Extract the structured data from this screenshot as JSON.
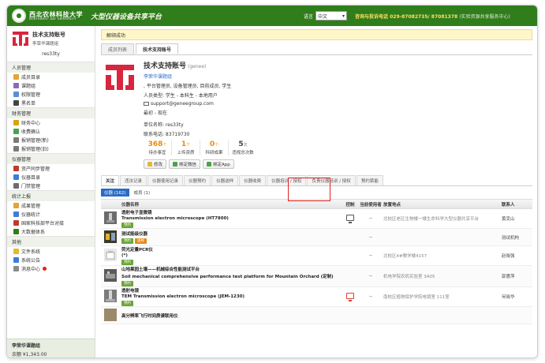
{
  "header": {
    "logo_cn": "西北农林科技大学",
    "logo_en": "NORTHWEST A&F UNIVERSITY",
    "slogan": "大型仪器设备共享平台",
    "lang_label": "语言",
    "lang_value": "中文",
    "hotline": "咨询与投诉电话 029-87082735/ 87081378",
    "hotline_note": "(实验资源共享服务中心)"
  },
  "sidebar": {
    "user_name": "技术支持账号",
    "user_group": "李荣华课题组",
    "user_id": "res33ty",
    "groups": [
      {
        "title": "人员管理",
        "items": [
          "成员目录",
          "课题组",
          "权限管理",
          "黑名单"
        ]
      },
      {
        "title": "财务管理",
        "items": [
          "财务中心",
          "收费确认",
          "报销管理(新)",
          "报销管理(旧)"
        ]
      },
      {
        "title": "仪器管理",
        "items": [
          "资产同步管理",
          "仪器目录",
          "门禁管理"
        ]
      },
      {
        "title": "统计上报",
        "items": [
          "成果管理",
          "仪器统计",
          "国家科技部平台对接",
          "大数据体系"
        ]
      },
      {
        "title": "其他",
        "items": [
          "文件系统",
          "系统公告",
          "消息中心"
        ]
      }
    ],
    "footer_group": "李荣华课题组",
    "footer_balance": "¥1,343.00"
  },
  "main": {
    "notice": "解绑成功",
    "top_tabs": [
      "成员列表",
      "技术支持账号"
    ],
    "profile": {
      "name": "技术支持账号",
      "account": "(genee)",
      "group": "李荣华课题组",
      "roles": ", 平台管理员, 设备管理员, 目前成员, 学生",
      "type": "人员类型: 学生 - 本科生 - 本地用户",
      "email": "support@geneegroup.com",
      "period": "最初 - 现在",
      "unit": "单位名称: res33ty",
      "phone": "联系电话: 83719730"
    },
    "stats": [
      {
        "value": "368",
        "unit": "个",
        "label": "待办事宜",
        "accent": true
      },
      {
        "value": "1",
        "unit": "个",
        "label": "上传资质",
        "accent": true
      },
      {
        "value": "0",
        "unit": "个",
        "label": "科研成果",
        "accent": true
      },
      {
        "value": "5",
        "unit": "次",
        "label": "违规总次数",
        "accent": false
      }
    ],
    "buttons": [
      "修改",
      "绑定微信",
      "绑定App"
    ],
    "sub_tabs": [
      "关注",
      "违法记录",
      "仪器使用记录",
      "仪器预约",
      "仪器送样",
      "仪器收费",
      "仪器培训 / 授权",
      "负责仪器培训 / 授权",
      "预约禁能"
    ],
    "filters": {
      "instruments": "仪器 (162)",
      "members": "成员 (1)"
    },
    "table": {
      "headers": [
        "仪器名称",
        "控制",
        "当前使用者",
        "放置地点",
        "联系人"
      ],
      "rows": [
        {
          "title": "透射电子显微镜",
          "subtitle": "Transmission electron microscope (HT7800)",
          "tags": [
            "预约"
          ],
          "ctrl": "monitor",
          "user": "--",
          "location": "北校区老区生物楼一楼生命科学大型仪器共享平台",
          "contact": "黄克山"
        },
        {
          "title": "测试能级仪器",
          "subtitle": "",
          "tags": [
            "预约",
            "送样"
          ],
          "ctrl": "",
          "user": "--",
          "location": "",
          "contact": "测试机构"
        },
        {
          "title": "荧光定量PCR仪",
          "subtitle": "(*)",
          "tags": [
            "预约"
          ],
          "ctrl": "",
          "user": "--",
          "location": "北校区4#教学楼4157",
          "contact": "赵晓强"
        },
        {
          "title": "山地果园土壤——机械综合性能测试平台",
          "subtitle": "Soil mechanical comprehensive performance test platform for Mountain Orchard (定制)",
          "tags": [
            "预约"
          ],
          "ctrl": "",
          "user": "--",
          "location": "机电学院农机实验室 3A05",
          "contact": "郭惠萍"
        },
        {
          "title": "透射电镜",
          "subtitle": "TEM Transmission electron microscope (JEM-1230)",
          "tags": [
            "预约"
          ],
          "ctrl": "monitor-red",
          "user": "--",
          "location": "南校区植物保护学院电镜室 111室",
          "contact": "何晓华"
        },
        {
          "title": "高分辨率飞行时间质谱联用仪",
          "subtitle": "",
          "tags": [],
          "ctrl": "",
          "user": "",
          "location": "",
          "contact": ""
        }
      ]
    }
  },
  "colors": {
    "brand_green": "#2f7d1b",
    "accent_orange": "#f08a00",
    "link_blue": "#2a6bc4",
    "highlight_red": "#e02020"
  }
}
